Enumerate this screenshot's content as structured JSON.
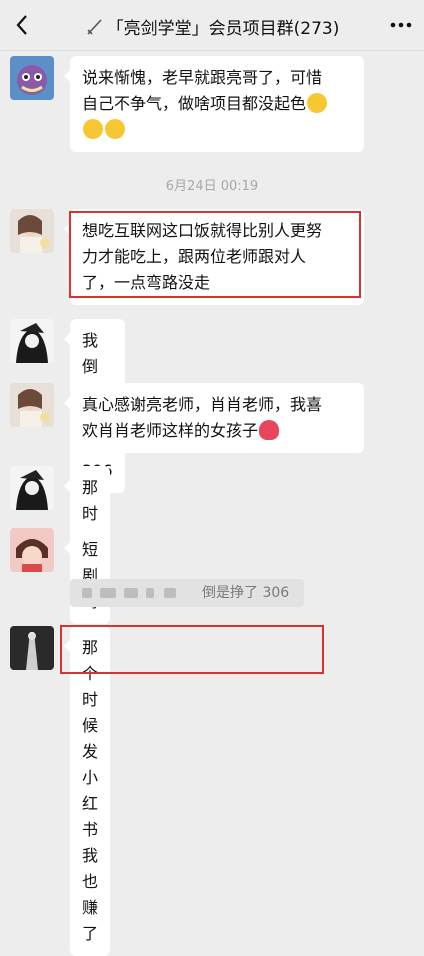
{
  "header": {
    "title": "「亮剑学堂」会员项目群(273)",
    "back_icon": "chevron-left-icon",
    "more_icon": "more-dots-icon"
  },
  "messages": [
    {
      "text_line1": "说来惭愧，老早就跟亮哥了，可惜",
      "text_line2": "自己不争气，做啥项目都没起色",
      "emoji": [
        "laugh-cry-emoji",
        "laugh-cry-emoji",
        "crying-emoji"
      ]
    },
    {
      "timestamp": "6月24日 00:19"
    },
    {
      "text_line1": "想吃互联网这口饭就得比别人更努",
      "text_line2": "力才能吃上，跟两位老师跟对人",
      "text_line3": "了，一点弯路没走",
      "highlighted": true
    },
    {
      "text": "我倒是挣了 306"
    },
    {
      "text_line1": "真心感谢亮老师，肖肖老师，我喜",
      "text_line2": "欢肖肖老师这样的女孩子",
      "emoji": [
        "red-heart-emoji"
      ]
    },
    {
      "text": "那时候"
    },
    {
      "text": "短剧吗"
    },
    {
      "quote_text": "倒是挣了 306"
    },
    {
      "text": "那个时候发小红书我也赚了",
      "highlighted": true
    }
  ],
  "colors": {
    "highlight": "#d93232",
    "background": "#ededed",
    "bubble": "#ffffff"
  }
}
